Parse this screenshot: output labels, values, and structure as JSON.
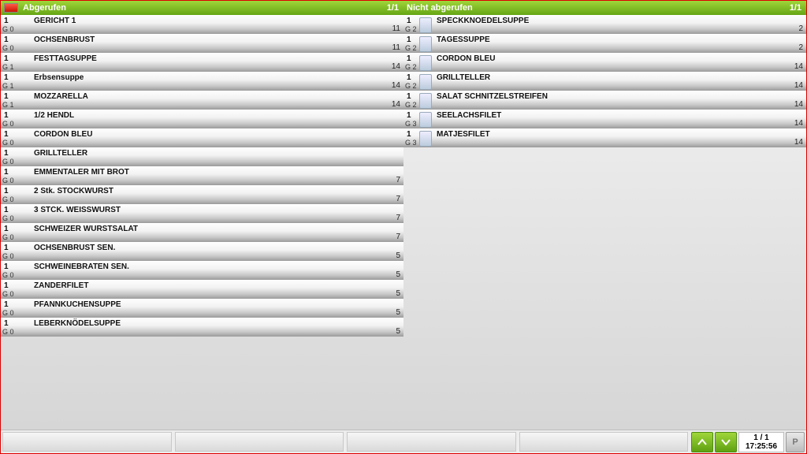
{
  "left": {
    "title": "Abgerufen",
    "page": "1/1",
    "status": "red",
    "rows": [
      {
        "qty": "1",
        "grp": "G 0",
        "name": "GERICHT 1",
        "val": "11"
      },
      {
        "qty": "1",
        "grp": "G 0",
        "name": "OCHSENBRUST",
        "val": "11"
      },
      {
        "qty": "1",
        "grp": "G 1",
        "name": "FESTTAGSUPPE",
        "val": "14"
      },
      {
        "qty": "1",
        "grp": "G 1",
        "name": "Erbsensuppe",
        "val": "14"
      },
      {
        "qty": "1",
        "grp": "G 1",
        "name": "MOZZARELLA",
        "val": "14"
      },
      {
        "qty": "1",
        "grp": "G 0",
        "name": "1/2 HENDL",
        "val": ""
      },
      {
        "qty": "1",
        "grp": "G 0",
        "name": "CORDON BLEU",
        "val": ""
      },
      {
        "qty": "1",
        "grp": "G 0",
        "name": "GRILLTELLER",
        "val": ""
      },
      {
        "qty": "1",
        "grp": "G 0",
        "name": "EMMENTALER MIT BROT",
        "val": "7"
      },
      {
        "qty": "1",
        "grp": "G 0",
        "name": " 2 Stk. STOCKWURST",
        "val": "7"
      },
      {
        "qty": "1",
        "grp": "G 0",
        "name": " 3 STCK. WEISSWURST",
        "val": "7"
      },
      {
        "qty": "1",
        "grp": "G 0",
        "name": "SCHWEIZER WURSTSALAT",
        "val": "7"
      },
      {
        "qty": "1",
        "grp": "G 0",
        "name": "OCHSENBRUST SEN.",
        "val": "5"
      },
      {
        "qty": "1",
        "grp": "G 0",
        "name": "SCHWEINEBRATEN SEN.",
        "val": "5"
      },
      {
        "qty": "1",
        "grp": "G 0",
        "name": "ZANDERFILET",
        "val": "5"
      },
      {
        "qty": "1",
        "grp": "G 0",
        "name": "PFANNKUCHENSUPPE",
        "val": "5"
      },
      {
        "qty": "1",
        "grp": "G 0",
        "name": "LEBERKNÖDELSUPPE",
        "val": "5"
      }
    ]
  },
  "right": {
    "title": "Nicht abgerufen",
    "page": "1/1",
    "rows": [
      {
        "qty": "1",
        "grp": "G 2",
        "name": "SPECKKNOEDELSUPPE",
        "val": "2",
        "chip": true
      },
      {
        "qty": "1",
        "grp": "G 2",
        "name": "TAGESSUPPE",
        "val": "2",
        "chip": true
      },
      {
        "qty": "1",
        "grp": "G 2",
        "name": "CORDON BLEU",
        "val": "14",
        "chip": true
      },
      {
        "qty": "1",
        "grp": "G 2",
        "name": "GRILLTELLER",
        "val": "14",
        "chip": true
      },
      {
        "qty": "1",
        "grp": "G 2",
        "name": "SALAT SCHNITZELSTREIFEN",
        "val": "14",
        "chip": true
      },
      {
        "qty": "1",
        "grp": "G 3",
        "name": "SEELACHSFILET",
        "val": "14",
        "chip": true
      },
      {
        "qty": "1",
        "grp": "G 3",
        "name": "MATJESFILET",
        "val": "14",
        "chip": true
      }
    ]
  },
  "footer": {
    "page": "1 / 1",
    "time": "17:25:56",
    "p_label": "P"
  }
}
